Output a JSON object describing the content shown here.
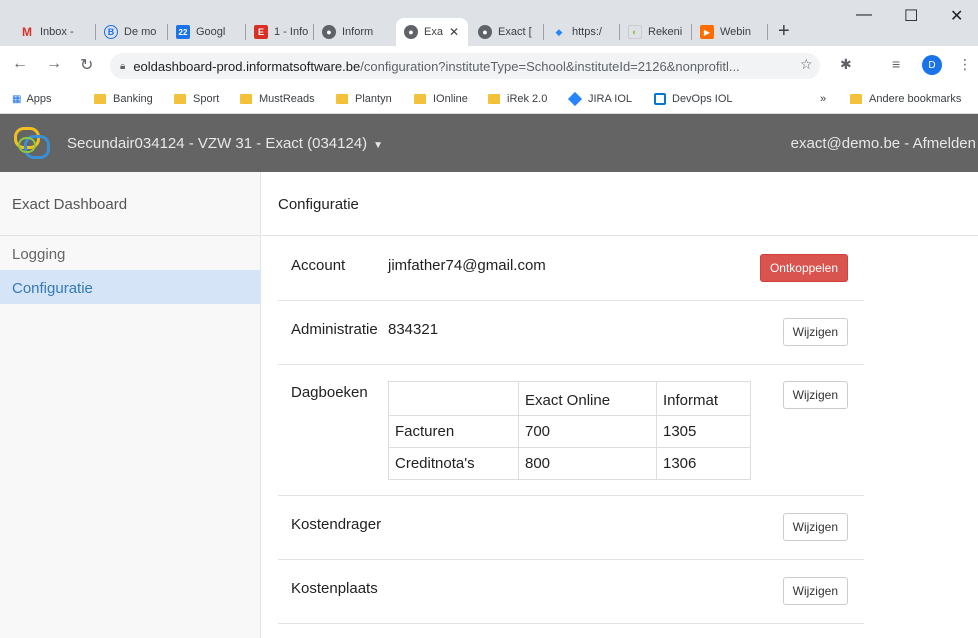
{
  "browser": {
    "tabs": [
      {
        "label": "Inbox -",
        "icon": "gmail-icon"
      },
      {
        "label": "De mo",
        "icon": "b-icon"
      },
      {
        "label": "Googl",
        "icon": "calendar-icon"
      },
      {
        "label": "1 - Info",
        "icon": "e-icon"
      },
      {
        "label": "Inform",
        "icon": "globe-icon"
      },
      {
        "label": "Exa",
        "icon": "globe-icon"
      },
      {
        "label": "Exact [",
        "icon": "globe-icon"
      },
      {
        "label": "https:/",
        "icon": "jira-icon"
      },
      {
        "label": "Rekeni",
        "icon": "reken-icon"
      },
      {
        "label": "Webin",
        "icon": "play-icon"
      }
    ],
    "new_tab": "+",
    "window": {
      "minimize": "—",
      "maximize": "☐",
      "close": "✕"
    },
    "url_host": "eoldashboard-prod.informatsoftware.be",
    "url_path": "/configuration?instituteType=School&instituteId=2126&nonprofitl...",
    "profile_initial": "D",
    "bookmarks": [
      {
        "label": "Apps",
        "icon": "apps-icon"
      },
      {
        "label": "Banking",
        "icon": "folder-icon"
      },
      {
        "label": "Sport",
        "icon": "folder-icon"
      },
      {
        "label": "MustReads",
        "icon": "folder-icon"
      },
      {
        "label": "Plantyn",
        "icon": "folder-icon"
      },
      {
        "label": "IOnline",
        "icon": "folder-icon"
      },
      {
        "label": "iRek 2.0",
        "icon": "folder-icon"
      },
      {
        "label": "JIRA IOL",
        "icon": "jira-icon"
      },
      {
        "label": "DevOps IOL",
        "icon": "devops-icon"
      }
    ],
    "bookmarks_more": "»",
    "other_bookmarks": "Andere bookmarks"
  },
  "header": {
    "school": "Secundair034124 - VZW 31 - Exact (034124)",
    "user": "exact@demo.be - Afmelden",
    "colors": {
      "bar": "#646464",
      "logo_yellow": "#f2c01e",
      "logo_blue": "#3a8fd6",
      "logo_green": "#8dc63f"
    }
  },
  "sidebar": {
    "title": "Exact Dashboard",
    "items": [
      {
        "label": "Logging",
        "active": false
      },
      {
        "label": "Configuratie",
        "active": true
      }
    ]
  },
  "main": {
    "title": "Configuratie",
    "account": {
      "label": "Account",
      "value": "jimfather74@gmail.com",
      "button": "Ontkoppelen"
    },
    "administratie": {
      "label": "Administratie",
      "value": "834321",
      "button": "Wijzigen"
    },
    "dagboeken": {
      "label": "Dagboeken",
      "button": "Wijzigen",
      "headers": [
        "",
        "Exact Online",
        "Informat"
      ],
      "rows": [
        [
          "Facturen",
          "700",
          "1305"
        ],
        [
          "Creditnota's",
          "800",
          "1306"
        ]
      ]
    },
    "kostendrager": {
      "label": "Kostendrager",
      "button": "Wijzigen"
    },
    "kostenplaats": {
      "label": "Kostenplaats",
      "button": "Wijzigen"
    }
  }
}
